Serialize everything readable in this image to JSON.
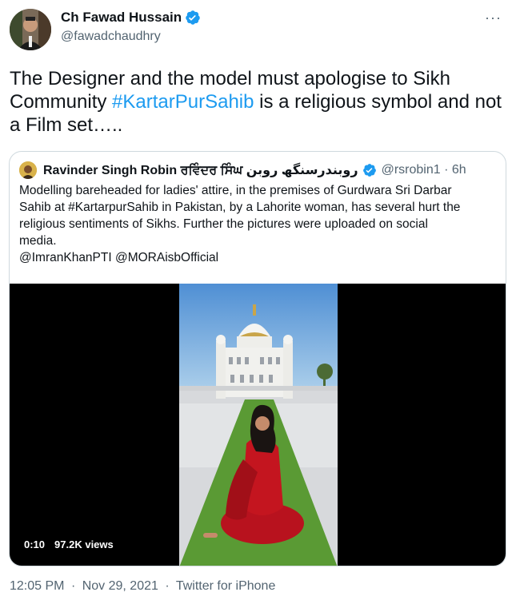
{
  "author": {
    "name": "Ch Fawad Hussain",
    "handle": "@fawadchaudhry"
  },
  "more_icon": "···",
  "tweet": {
    "text_before": "The Designer and the model must apologise to Sikh Community ",
    "hashtag": "#KartarPurSahib",
    "text_after": " is a religious symbol and not a Film set….."
  },
  "quoted": {
    "name": "Ravinder Singh Robin ਰਵਿੰਦਰ ਸਿੰਘ روبندرسنگھ روبن",
    "handle_time": "@rsrobin1 · 6h",
    "lines": [
      "Modelling bareheaded for ladies' attire, in the premises  of Gurdwara Sri Darbar",
      "Sahib at #KartarpurSahib in Pakistan, by a Lahorite woman,  has several hurt the",
      "religious sentiments of Sikhs. Further the pictures were uploaded on social",
      "media.",
      "@ImranKhanPTI  @MORAisbOfficial"
    ],
    "video": {
      "duration": "0:10",
      "views": "97.2K views"
    }
  },
  "footer": {
    "time": "12:05 PM",
    "date": "Nov 29, 2021",
    "source": "Twitter for iPhone",
    "sep": "·"
  },
  "colors": {
    "verified": "#1d9bf0",
    "hashtag": "#1d9bf0",
    "muted": "#536471"
  }
}
